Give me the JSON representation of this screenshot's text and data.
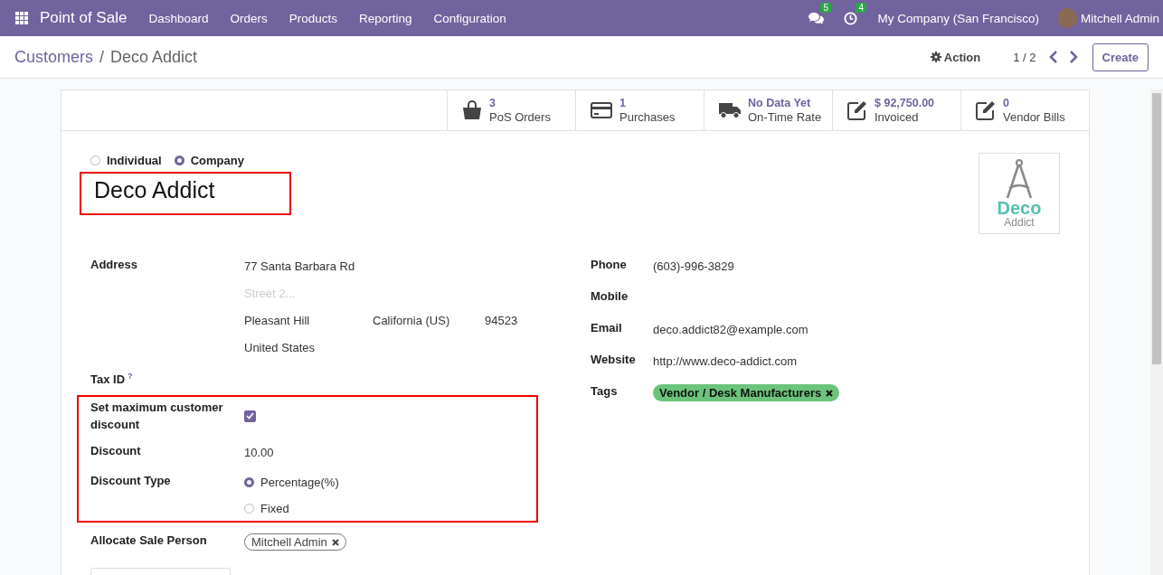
{
  "navbar": {
    "app_name": "Point of Sale",
    "menu": [
      "Dashboard",
      "Orders",
      "Products",
      "Reporting",
      "Configuration"
    ],
    "messages_count": "5",
    "activities_count": "4",
    "company": "My Company (San Francisco)",
    "user": "Mitchell Admin"
  },
  "control_panel": {
    "breadcrumb": [
      "Customers",
      "Deco Addict"
    ],
    "breadcrumb_separator": "/",
    "action": "Action",
    "pager": "1 / 2",
    "create": "Create"
  },
  "stat_buttons": [
    {
      "kind": "bag",
      "value": "3",
      "label": "PoS Orders"
    },
    {
      "kind": "card",
      "value": "1",
      "label": "Purchases"
    },
    {
      "kind": "truck",
      "value": "No Data Yet",
      "label": "On-Time Rate"
    },
    {
      "kind": "invoice",
      "value": "$ 92,750.00",
      "label": "Invoiced"
    },
    {
      "kind": "bill",
      "value": "0",
      "label": "Vendor Bills"
    }
  ],
  "company_type": [
    {
      "label": "Individual",
      "selected": false
    },
    {
      "label": "Company",
      "selected": true
    }
  ],
  "name": "Deco Addict",
  "logo": {
    "title": "Deco",
    "subtitle": "Addict"
  },
  "address": {
    "label": "Address",
    "street": "77 Santa Barbara Rd",
    "street2_placeholder": "Street 2...",
    "city": "Pleasant Hill",
    "state": "California (US)",
    "zip": "94523",
    "country": "United States"
  },
  "tax_id": {
    "label": "Tax ID",
    "help": "?"
  },
  "discount_section": {
    "max_discount": {
      "label": "Set maximum customer discount",
      "checked": true
    },
    "discount": {
      "label": "Discount",
      "value": "10.00"
    },
    "discount_type": {
      "label": "Discount Type",
      "options": [
        {
          "label": "Percentage(%)",
          "selected": true
        },
        {
          "label": "Fixed",
          "selected": false
        }
      ]
    }
  },
  "sale_person": {
    "label": "Allocate Sale Person",
    "tags": [
      "Mitchell Admin"
    ]
  },
  "contact_fields": [
    {
      "label": "Phone",
      "value": "(603)-996-3829"
    },
    {
      "label": "Mobile"
    },
    {
      "label": "Email",
      "value": "deco.addict82@example.com"
    },
    {
      "label": "Website",
      "value": "http://www.deco-addict.com"
    }
  ],
  "tags": {
    "label": "Tags",
    "items": [
      {
        "label": "Vendor / Desk Manufacturers",
        "color": "#6cc47c"
      }
    ]
  }
}
